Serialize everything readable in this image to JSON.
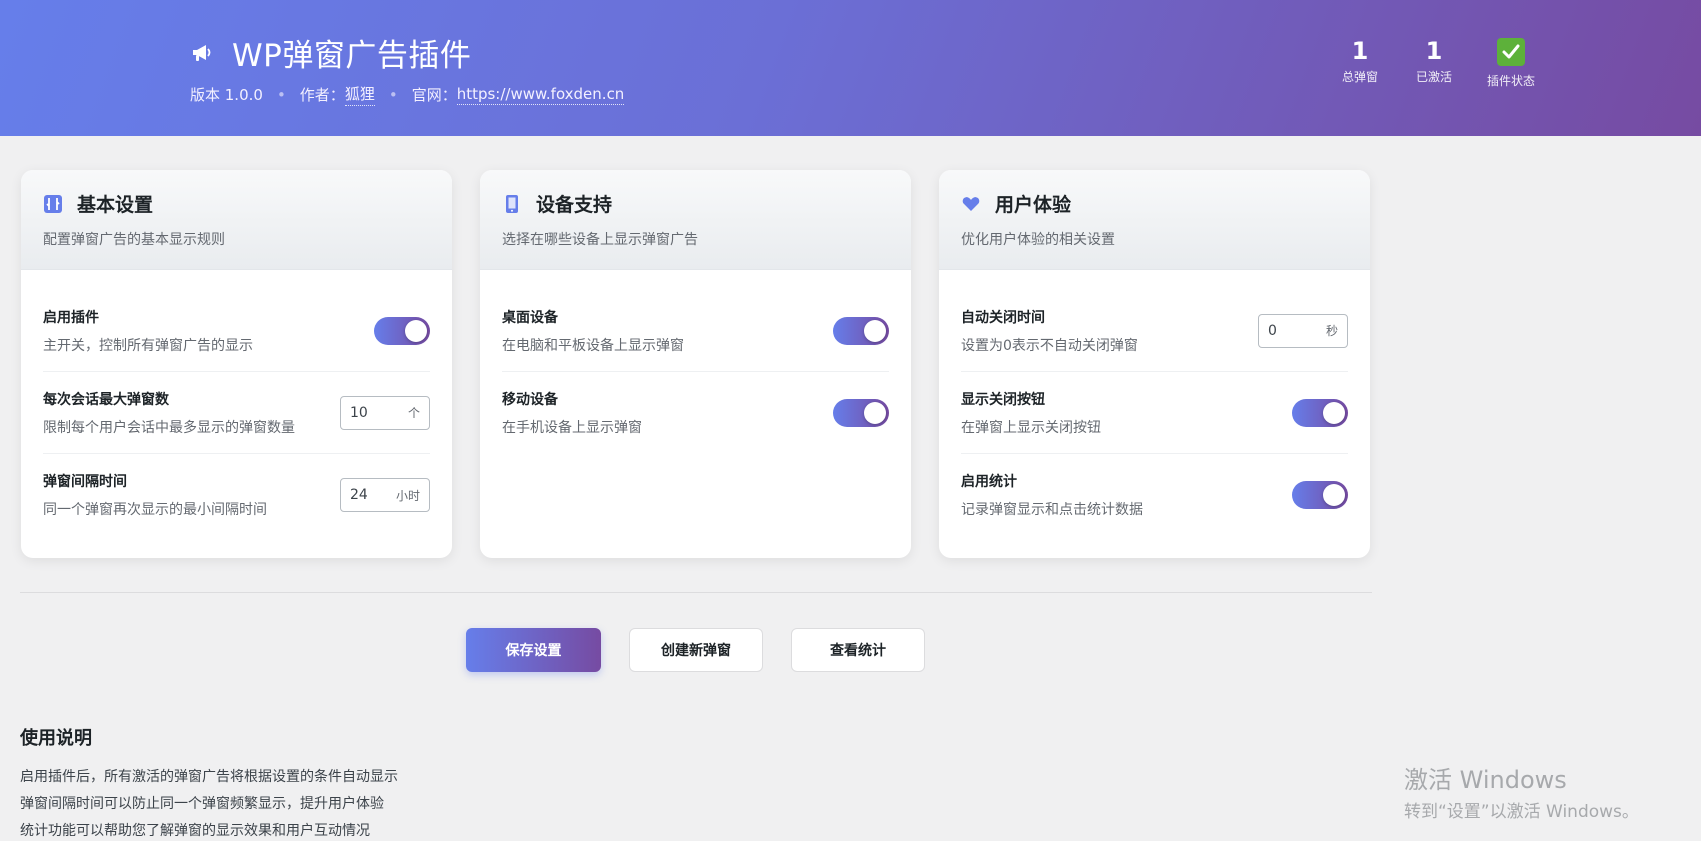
{
  "header": {
    "title": "WP弹窗广告插件",
    "version": "版本 1.0.0",
    "author_label": "作者：",
    "author": "狐狸",
    "site_label": "官网：",
    "site_url": "https://www.foxden.cn",
    "icon": "megaphone-icon",
    "stats": [
      {
        "value": "1",
        "label": "总弹窗"
      },
      {
        "value": "1",
        "label": "已激活"
      },
      {
        "label": "插件状态",
        "icon": "check-mark-icon"
      }
    ]
  },
  "cards": [
    {
      "title": "基本设置",
      "subtitle": "配置弹窗广告的基本显示规则",
      "icon": "sliders-icon",
      "rows": [
        {
          "label": "启用插件",
          "desc": "主开关，控制所有弹窗广告的显示",
          "control": "toggle",
          "on": true
        },
        {
          "label": "每次会话最大弹窗数",
          "desc": "限制每个用户会话中最多显示的弹窗数量",
          "control": "number",
          "value": "10",
          "unit": "个"
        },
        {
          "label": "弹窗间隔时间",
          "desc": "同一个弹窗再次显示的最小间隔时间",
          "control": "number",
          "value": "24",
          "unit": "小时"
        }
      ]
    },
    {
      "title": "设备支持",
      "subtitle": "选择在哪些设备上显示弹窗广告",
      "icon": "mobile-phone-icon",
      "rows": [
        {
          "label": "桌面设备",
          "desc": "在电脑和平板设备上显示弹窗",
          "control": "toggle",
          "on": true
        },
        {
          "label": "移动设备",
          "desc": "在手机设备上显示弹窗",
          "control": "toggle",
          "on": true
        }
      ]
    },
    {
      "title": "用户体验",
      "subtitle": "优化用户体验的相关设置",
      "icon": "heart-icon",
      "rows": [
        {
          "label": "自动关闭时间",
          "desc": "设置为0表示不自动关闭弹窗",
          "control": "number",
          "value": "0",
          "unit": "秒"
        },
        {
          "label": "显示关闭按钮",
          "desc": "在弹窗上显示关闭按钮",
          "control": "toggle",
          "on": true
        },
        {
          "label": "启用统计",
          "desc": "记录弹窗显示和点击统计数据",
          "control": "toggle",
          "on": true
        }
      ]
    }
  ],
  "actions": {
    "save": "保存设置",
    "create": "创建新弹窗",
    "stats": "查看统计"
  },
  "help": {
    "title": "使用说明",
    "items": [
      "启用插件后，所有激活的弹窗广告将根据设置的条件自动显示",
      "弹窗间隔时间可以防止同一个弹窗频繁显示，提升用户体验",
      "统计功能可以帮助您了解弹窗的显示效果和用户互动情况"
    ]
  },
  "watermark": {
    "line1": "激活 Windows",
    "line2": "转到“设置”以激活 Windows。"
  },
  "colors": {
    "gradient_start": "#667eea",
    "gradient_end": "#764ba2",
    "status_green": "#5db13a"
  }
}
